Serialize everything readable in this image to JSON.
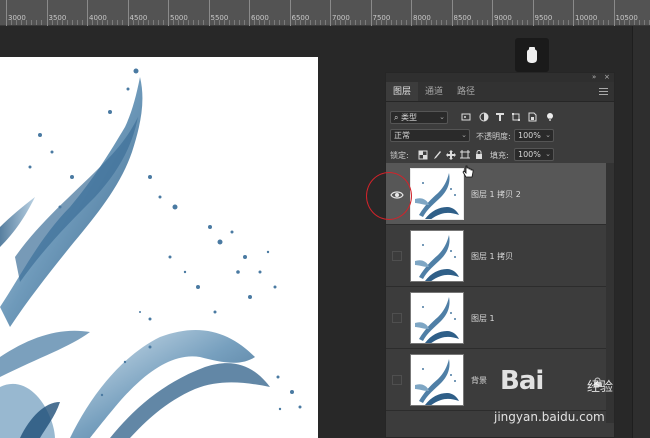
{
  "ruler": {
    "labels": [
      "3000",
      "3500",
      "4000",
      "4500",
      "5000",
      "5500",
      "6000",
      "6500",
      "7000",
      "7500",
      "8000",
      "8500",
      "9000",
      "9500",
      "10000",
      "10500"
    ]
  },
  "panel": {
    "tabs": [
      {
        "label": "图层",
        "active": true
      },
      {
        "label": "通道",
        "active": false
      },
      {
        "label": "路径",
        "active": false
      }
    ],
    "filter": {
      "kind_label": "类型"
    },
    "blend_mode": "正常",
    "opacity_label": "不透明度:",
    "opacity_value": "100%",
    "lock_label": "锁定:",
    "fill_label": "填充:",
    "fill_value": "100%",
    "layers": [
      {
        "name": "图层 1 拷贝 2",
        "visible": true,
        "active": true,
        "locked": false
      },
      {
        "name": "图层 1 拷贝",
        "visible": false,
        "active": false,
        "locked": false
      },
      {
        "name": "图层 1",
        "visible": false,
        "active": false,
        "locked": false
      },
      {
        "name": "背景",
        "visible": false,
        "active": false,
        "locked": true
      }
    ]
  },
  "watermark": {
    "brand": "Bai",
    "brand2": "百",
    "cn": "经验",
    "url": "jingyan.baidu.com"
  },
  "colors": {
    "accent_circle": "#d2232a",
    "panel_bg": "#3c3c3c",
    "active_layer_bg": "#575757"
  }
}
